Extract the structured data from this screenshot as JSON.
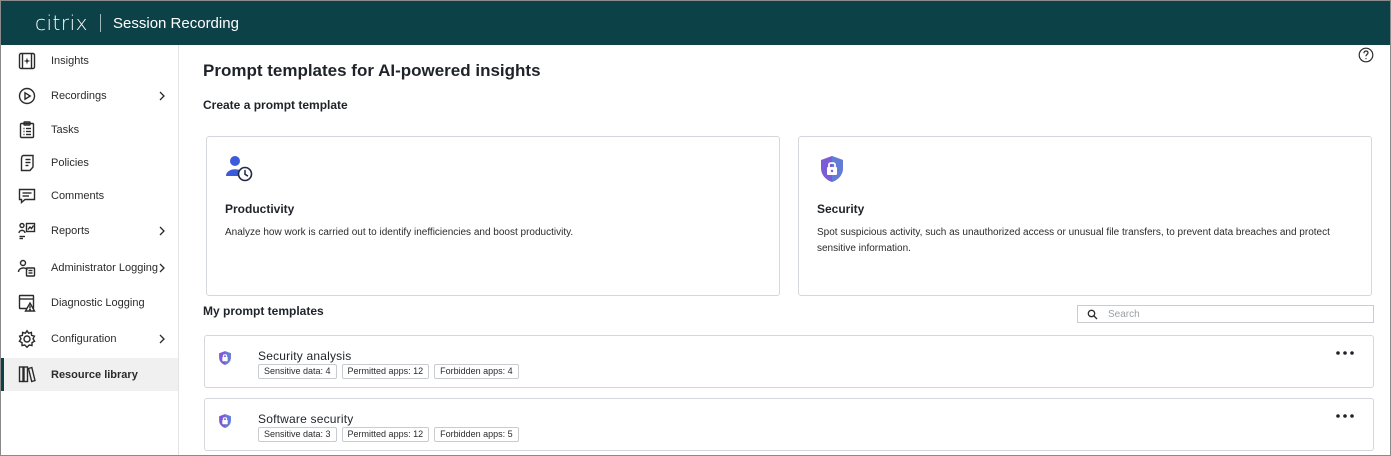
{
  "header": {
    "brand": "citrix",
    "product": "Session Recording"
  },
  "sidebar": {
    "items": [
      {
        "label": "Insights",
        "icon": "insights-icon",
        "has_submenu": false
      },
      {
        "label": "Recordings",
        "icon": "play-circle-icon",
        "has_submenu": true
      },
      {
        "label": "Tasks",
        "icon": "clipboard-list-icon",
        "has_submenu": false
      },
      {
        "label": "Policies",
        "icon": "document-policy-icon",
        "has_submenu": false
      },
      {
        "label": "Comments",
        "icon": "comment-icon",
        "has_submenu": false
      },
      {
        "label": "Reports",
        "icon": "reports-icon",
        "has_submenu": true
      },
      {
        "label": "Administrator Logging",
        "icon": "admin-logging-icon",
        "has_submenu": true
      },
      {
        "label": "Diagnostic Logging",
        "icon": "diagnostic-logging-icon",
        "has_submenu": false
      },
      {
        "label": "Configuration",
        "icon": "gear-icon",
        "has_submenu": true
      },
      {
        "label": "Resource library",
        "icon": "library-books-icon",
        "has_submenu": false,
        "active": true
      }
    ]
  },
  "main": {
    "title": "Prompt templates for AI-powered insights",
    "create_section_title": "Create a prompt template",
    "create_cards": [
      {
        "title": "Productivity",
        "description": "Analyze how work is carried out to identify inefficiencies and boost productivity.",
        "icon": "user-clock-icon"
      },
      {
        "title": "Security",
        "description": "Spot suspicious activity, such as unauthorized access or unusual file transfers, to prevent data breaches and protect sensitive information.",
        "icon": "shield-lock-icon"
      }
    ],
    "my_section_title": "My prompt templates",
    "search": {
      "placeholder": "Search",
      "value": ""
    },
    "templates": [
      {
        "name": "Security analysis",
        "chips": [
          "Sensitive data: 4",
          "Permitted apps: 12",
          "Forbidden apps: 4"
        ],
        "icon": "shield-lock-icon"
      },
      {
        "name": "Software security",
        "chips": [
          "Sensitive data: 3",
          "Permitted apps: 12",
          "Forbidden apps: 5"
        ],
        "icon": "shield-lock-icon"
      }
    ]
  },
  "colors": {
    "header_bg": "#0c4147",
    "accent": "#0c4147",
    "border": "#d4d7db",
    "shield": "#7b5bd6"
  }
}
